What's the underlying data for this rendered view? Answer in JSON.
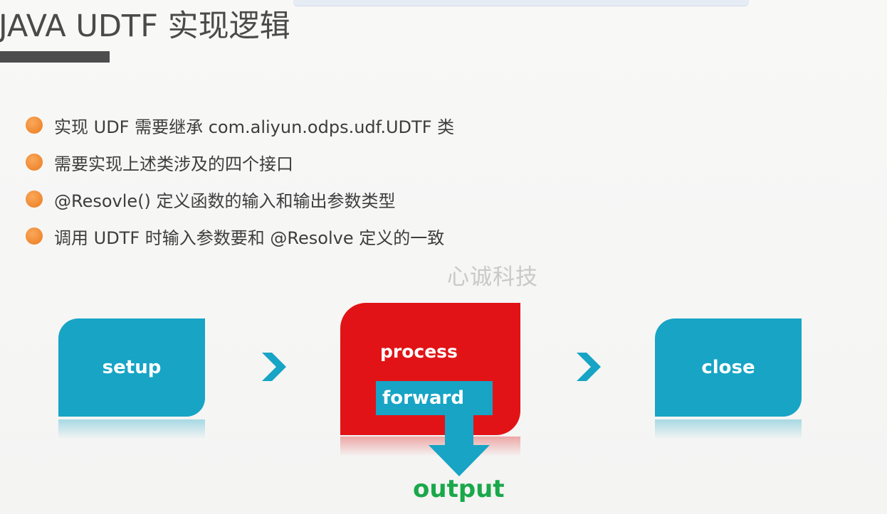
{
  "slide": {
    "title": "JAVA UDTF 实现逻辑",
    "watermark": "心诚科技"
  },
  "bullets": [
    "实现 UDF 需要继承 com.aliyun.odps.udf.UDTF 类",
    "需要实现上述类涉及的四个接口",
    "@Resovle() 定义函数的输入和输出参数类型",
    "调用 UDTF 时输入参数要和 @Resolve 定义的一致"
  ],
  "flow": {
    "setup": "setup",
    "process": "process",
    "forward": "forward",
    "close": "close",
    "output": "output"
  },
  "colors": {
    "teal": "#17a4c5",
    "red": "#e11316",
    "orange_bullet": "#ec7a1f",
    "output_green": "#1aa84a",
    "title_gray": "#4a4a4a"
  },
  "icons": [
    "chevron-right-icon",
    "down-arrow-icon",
    "bullet-dot-icon"
  ]
}
